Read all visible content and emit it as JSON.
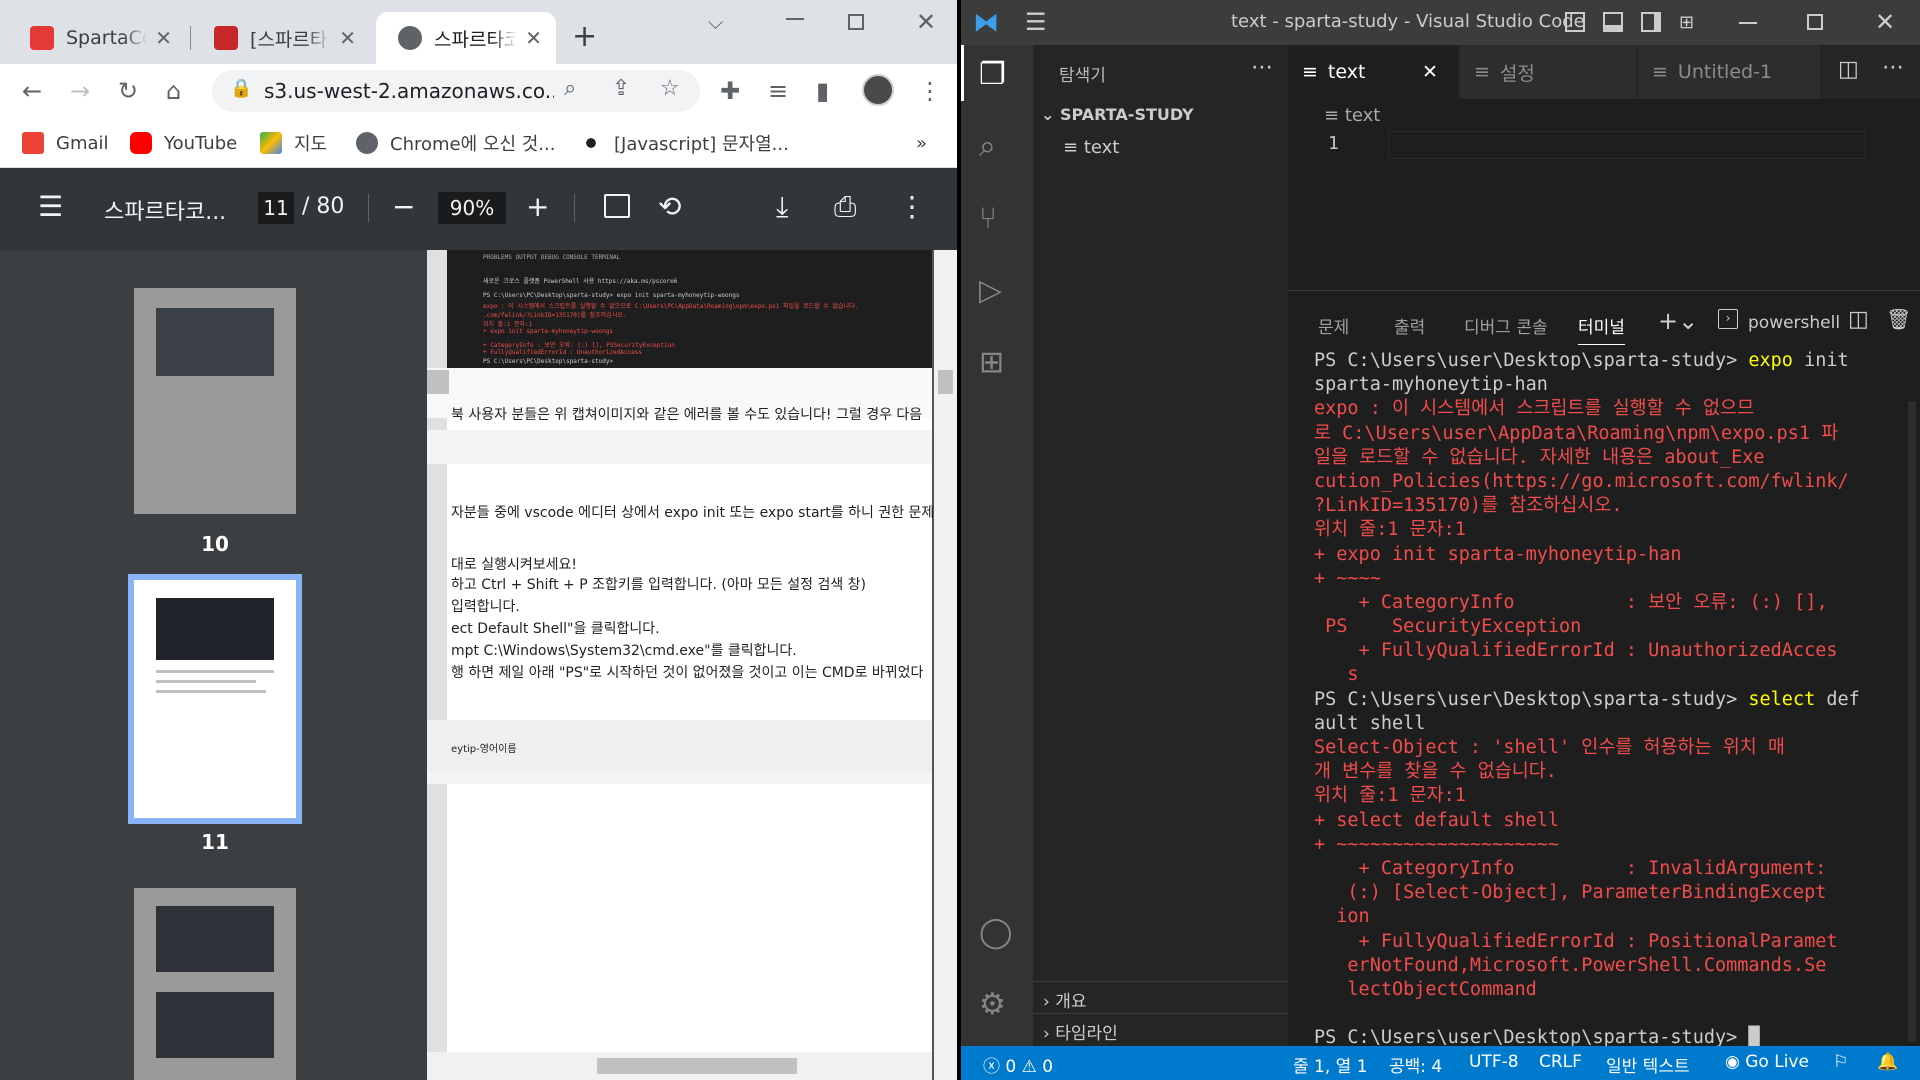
{
  "chrome": {
    "tabs": [
      {
        "label": "SpartaCoding",
        "color": "#e53935"
      },
      {
        "label": "[스파르타코딩클럽]",
        "color": "#c62828"
      },
      {
        "label": "스파르타코딩클럽",
        "active": true
      }
    ],
    "new_tab": "+",
    "address": "s3.us-west-2.amazonaws.co...",
    "bookmarks": [
      {
        "label": "Gmail",
        "icon": "gmail-icon"
      },
      {
        "label": "YouTube",
        "icon": "youtube-icon"
      },
      {
        "label": "지도",
        "icon": "maps-icon"
      },
      {
        "label": "Chrome에 오신 것...",
        "icon": "globe-icon"
      },
      {
        "label": "[Javascript] 문자열...",
        "icon": "dots-icon"
      }
    ],
    "bookmarks_more": "»"
  },
  "pdf": {
    "title": "스파르타코...",
    "page_current": "11",
    "page_sep": "/ 80",
    "zoom": "90%",
    "thumbnails": [
      {
        "number": "10"
      },
      {
        "number": "11",
        "selected": true
      },
      {
        "number": "12"
      }
    ],
    "body_lines": [
      "북 사용자 분들은 위 캡쳐이미지와 같은 에러를 볼 수도 있습니다! 그럴 경우 다음",
      "자분들 중에 vscode 에디터 상에서 expo init 또는 expo start를 하니 권한 문제가",
      "대로 실행시켜보세요!",
      "하고 Ctrl + Shift + P 조합키를 입력합니다. (아마 모든 설정 검색 창)",
      "입력합니다.",
      "ect Default Shell\"을 클릭합니다.",
      "mpt C:\\Windows\\System32\\cmd.exe\"를 클릭합니다.",
      "행 하면 제일 아래 \"PS\"로 시작하던 것이 없어졌을 것이고 이는 CMD로 바뀌었다",
      "eytip-영어이름"
    ],
    "shot_tabs": "PROBLEMS   OUTPUT   DEBUG CONSOLE   TERMINAL",
    "shot_lines": [
      "새로운 크로스 플랫폼 PowerShell 사용 https://aka.ms/pscore6",
      "PS C:\\Users\\PC\\Desktop\\sparta-study> expo init sparta-myhoneytip-woongs",
      "expo : 이 시스템에서 스크립트를 실행할 수 없으므로 C:\\Users\\PC\\AppData\\Roaming\\npm\\expo.ps1 파일을 로드할 수 없습니다.",
      ".com/fwlink/?LinkID=135170)를 참조하십시오.",
      "위치 줄:1 문자:1",
      "+ expo init sparta-myhoneytip-woongs",
      "    + CategoryInfo          : 보안 오류: (:) [], PSSecurityException",
      "    + FullyQualifiedErrorId : UnauthorizedAccess",
      "PS C:\\Users\\PC\\Desktop\\sparta-study> "
    ]
  },
  "vscode": {
    "title": "text - sparta-study - Visual Studio Code",
    "explorer_title": "탐색기",
    "workspace": "SPARTA-STUDY",
    "files": [
      "text"
    ],
    "outline": "개요",
    "timeline": "타임라인",
    "editor_tabs": [
      {
        "label": "text",
        "active": true
      },
      {
        "label": "설정"
      },
      {
        "label": "Untitled-1"
      }
    ],
    "breadcrumb": "text",
    "line_number": "1",
    "panel_tabs": [
      "문제",
      "출력",
      "디버그 콘솔",
      "터미널"
    ],
    "shell": "powershell",
    "terminal_lines": [
      [
        {
          "t": "PS C:\\Users\\user\\Desktop\\sparta-study> "
        },
        {
          "t": "expo",
          "c": "cmd"
        },
        {
          "t": " init"
        }
      ],
      [
        {
          "t": "sparta-myhoneytip-han"
        }
      ],
      [
        {
          "t": "expo : 이 시스템에서 스크립트를 실행할 수 없으므",
          "c": "err"
        }
      ],
      [
        {
          "t": "로 C:\\Users\\user\\AppData\\Roaming\\npm\\expo.ps1 파",
          "c": "err"
        }
      ],
      [
        {
          "t": "일을 로드할 수 없습니다. 자세한 내용은 about_Exe",
          "c": "err"
        }
      ],
      [
        {
          "t": "cution_Policies(https://go.microsoft.com/fwlink/",
          "c": "err"
        }
      ],
      [
        {
          "t": "?LinkID=135170)를 참조하십시오.",
          "c": "err"
        }
      ],
      [
        {
          "t": "위치 줄:1 문자:1",
          "c": "err"
        }
      ],
      [
        {
          "t": "+ expo init sparta-myhoneytip-han",
          "c": "err"
        }
      ],
      [
        {
          "t": "+ ~~~~",
          "c": "err"
        }
      ],
      [
        {
          "t": "    + CategoryInfo          : 보안 오류: (:) [],",
          "c": "err"
        }
      ],
      [
        {
          "t": " PS    SecurityException",
          "c": "err"
        }
      ],
      [
        {
          "t": "    + FullyQualifiedErrorId : UnauthorizedAcces",
          "c": "err"
        }
      ],
      [
        {
          "t": "   s",
          "c": "err"
        }
      ],
      [
        {
          "t": "PS C:\\Users\\user\\Desktop\\sparta-study> "
        },
        {
          "t": "select",
          "c": "cmd"
        },
        {
          "t": " def"
        }
      ],
      [
        {
          "t": "ault shell"
        }
      ],
      [
        {
          "t": "Select-Object : 'shell' 인수를 허용하는 위치 매",
          "c": "err"
        }
      ],
      [
        {
          "t": "개 변수를 찾을 수 없습니다.",
          "c": "err"
        }
      ],
      [
        {
          "t": "위치 줄:1 문자:1",
          "c": "err"
        }
      ],
      [
        {
          "t": "+ select default shell",
          "c": "err"
        }
      ],
      [
        {
          "t": "+ ~~~~~~~~~~~~~~~~~~~~",
          "c": "err"
        }
      ],
      [
        {
          "t": "    + CategoryInfo          : InvalidArgument:",
          "c": "err"
        }
      ],
      [
        {
          "t": "   (:) [Select-Object], ParameterBindingExcept",
          "c": "err"
        }
      ],
      [
        {
          "t": "  ion",
          "c": "err"
        }
      ],
      [
        {
          "t": "    + FullyQualifiedErrorId : PositionalParamet",
          "c": "err"
        }
      ],
      [
        {
          "t": "   erNotFound,Microsoft.PowerShell.Commands.Se",
          "c": "err"
        }
      ],
      [
        {
          "t": "   lectObjectCommand",
          "c": "err"
        }
      ],
      [
        {
          "t": ""
        }
      ],
      [
        {
          "t": "PS C:\\Users\\user\\Desktop\\sparta-study> "
        },
        {
          "t": "█"
        }
      ]
    ],
    "status": {
      "errors": "0",
      "warnings": "0",
      "position": "줄 1, 열 1",
      "spaces": "공백: 4",
      "encoding": "UTF-8",
      "eol": "CRLF",
      "language": "일반 텍스트",
      "golive": "Go Live"
    }
  }
}
